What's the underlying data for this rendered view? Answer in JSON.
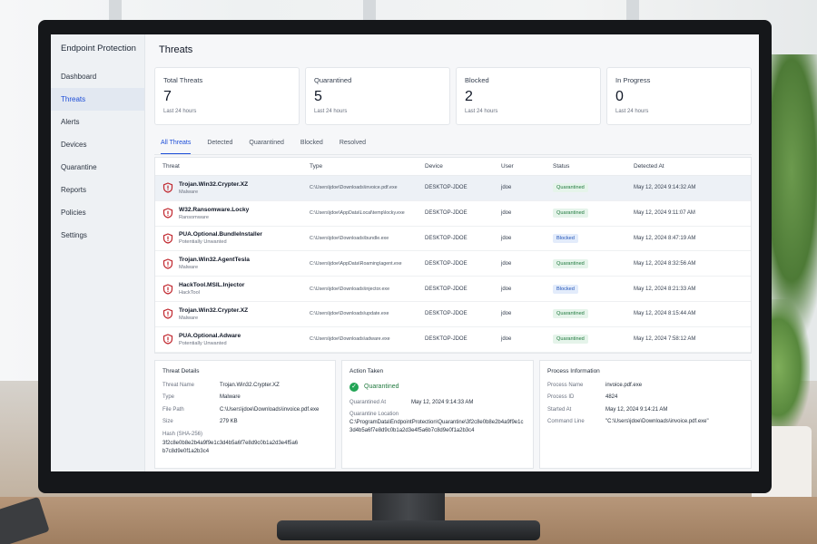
{
  "app": {
    "brand": "Endpoint Protection"
  },
  "sidebar": {
    "items": [
      {
        "label": "Dashboard"
      },
      {
        "label": "Threats",
        "active": true
      },
      {
        "label": "Alerts"
      },
      {
        "label": "Devices"
      },
      {
        "label": "Quarantine"
      },
      {
        "label": "Reports"
      },
      {
        "label": "Policies"
      },
      {
        "label": "Settings"
      }
    ]
  },
  "page": {
    "title": "Threats"
  },
  "stats": [
    {
      "label": "Total Threats",
      "value": "7",
      "sub": "Last 24 hours"
    },
    {
      "label": "Quarantined",
      "value": "5",
      "sub": "Last 24 hours"
    },
    {
      "label": "Blocked",
      "value": "2",
      "sub": "Last 24 hours"
    },
    {
      "label": "In Progress",
      "value": "0",
      "sub": "Last 24 hours"
    }
  ],
  "tabs": [
    {
      "label": "All Threats",
      "active": true
    },
    {
      "label": "Detected"
    },
    {
      "label": "Quarantined"
    },
    {
      "label": "Blocked"
    },
    {
      "label": "Resolved"
    }
  ],
  "table": {
    "headers": {
      "threat": "Threat",
      "type": "Type",
      "device": "Device",
      "user": "User",
      "status": "Status",
      "detected": "Detected At"
    },
    "rows": [
      {
        "name": "Trojan.Win32.Crypter.XZ",
        "category": "Malware",
        "path": "C:\\Users\\jdoe\\Downloads\\invoice.pdf.exe",
        "device": "DESKTOP-JDOE",
        "user": "jdoe",
        "status": "Quarantined",
        "detected": "May 12, 2024 9:14:32 AM"
      },
      {
        "name": "W32.Ransomware.Locky",
        "category": "Ransomware",
        "path": "C:\\Users\\jdoe\\AppData\\Local\\temp\\locky.exe",
        "device": "DESKTOP-JDOE",
        "user": "jdoe",
        "status": "Quarantined",
        "detected": "May 12, 2024 9:11:07 AM"
      },
      {
        "name": "PUA.Optional.BundleInstaller",
        "category": "Potentially Unwanted",
        "path": "C:\\Users\\jdoe\\Downloads\\bundle.exe",
        "device": "DESKTOP-JDOE",
        "user": "jdoe",
        "status": "Blocked",
        "detected": "May 12, 2024 8:47:19 AM"
      },
      {
        "name": "Trojan.Win32.AgentTesla",
        "category": "Malware",
        "path": "C:\\Users\\jdoe\\AppData\\Roaming\\agent.exe",
        "device": "DESKTOP-JDOE",
        "user": "jdoe",
        "status": "Quarantined",
        "detected": "May 12, 2024 8:32:56 AM"
      },
      {
        "name": "HackTool.MSIL.Injector",
        "category": "HackTool",
        "path": "C:\\Users\\jdoe\\Downloads\\injector.exe",
        "device": "DESKTOP-JDOE",
        "user": "jdoe",
        "status": "Blocked",
        "detected": "May 12, 2024 8:21:33 AM"
      },
      {
        "name": "Trojan.Win32.Crypter.XZ",
        "category": "Malware",
        "path": "C:\\Users\\jdoe\\Downloads\\update.exe",
        "device": "DESKTOP-JDOE",
        "user": "jdoe",
        "status": "Quarantined",
        "detected": "May 12, 2024 8:15:44 AM"
      },
      {
        "name": "PUA.Optional.Adware",
        "category": "Potentially Unwanted",
        "path": "C:\\Users\\jdoe\\Downloads\\adware.exe",
        "device": "DESKTOP-JDOE",
        "user": "jdoe",
        "status": "Quarantined",
        "detected": "May 12, 2024 7:58:12 AM"
      }
    ]
  },
  "threat_details": {
    "title": "Threat Details",
    "name_label": "Threat Name",
    "name": "Trojan.Win32.Crypter.XZ",
    "type_label": "Type",
    "type": "Malware",
    "path_label": "File Path",
    "path": "C:\\Users\\jdoe\\Downloads\\invoice.pdf.exe",
    "size_label": "Size",
    "size": "279 KB",
    "hash_label": "Hash (SHA-256)",
    "hash": "3f2c8e0b8e2b4a9f9e1c3d4b5a6f7e8d9c0b1a2d3e4f5a6b7c8d9e0f1a2b3c4"
  },
  "action_taken": {
    "title": "Action Taken",
    "status": "Quarantined",
    "quarantined_at_label": "Quarantined At",
    "quarantined_at": "May 12, 2024 9:14:33 AM",
    "location_label": "Quarantine Location",
    "location": "C:\\ProgramData\\EndpointProtection\\Quarantine\\3f2c8e0b8e2b4a9f9e1c3d4b5a6f7e8d9c0b1a2d3e4f5a6b7c8d9e0f1a2b3c4"
  },
  "process_info": {
    "title": "Process Information",
    "name_label": "Process Name",
    "name": "invoice.pdf.exe",
    "pid_label": "Process ID",
    "pid": "4824",
    "started_label": "Started At",
    "started": "May 12, 2024 9:14:21 AM",
    "cmd_label": "Command Line",
    "cmd": "\"C:\\Users\\jdoe\\Downloads\\invoice.pdf.exe\""
  },
  "colors": {
    "accent": "#1d4ed8",
    "quarantined": "#217a3f",
    "blocked": "#2456b8",
    "danger": "#c0262d"
  }
}
